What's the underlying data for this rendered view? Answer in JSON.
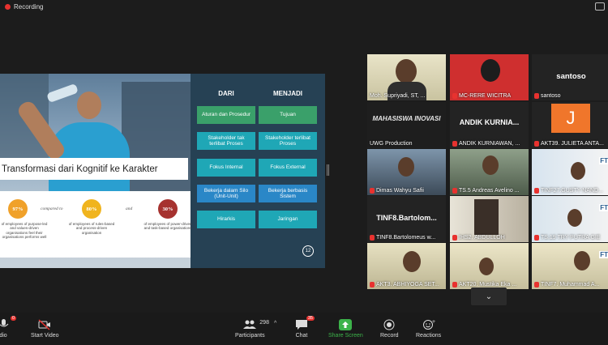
{
  "recording": {
    "label": "Recording"
  },
  "slide": {
    "title": "Transformasi dari Kognitif ke Karakter",
    "col_left_header": "DARI",
    "col_right_header": "MENJADI",
    "rows": [
      {
        "from": "Aturan dan Prosedur",
        "to": "Tujuan"
      },
      {
        "from": "Stakeholder tak terlibat Proses",
        "to": "Stakeholder terlibat Proses"
      },
      {
        "from": "Fokus Internal",
        "to": "Fokus External"
      },
      {
        "from": "Bekerja dalam Silo (Unit-Unit)",
        "to": "Bekerja berbasis Sistem"
      },
      {
        "from": "Hirarkis",
        "to": "Jaringan"
      }
    ],
    "stats": [
      {
        "value": "97%",
        "desc": "of employees of purpose-led and values-driven organisations feel their organisations performs well"
      },
      {
        "value": "80%",
        "desc": "of employees of rules-based and process-driven organisation"
      },
      {
        "value": "30%",
        "desc": "of employees of power-driven and task-based organisations"
      }
    ],
    "compared_to": "compared to",
    "and": "and",
    "page_number": "12"
  },
  "participants": [
    {
      "name": "Moh. Supriyadi, ST, ...",
      "muted": false,
      "active": true
    },
    {
      "name": "MC-RERE WICITRA",
      "muted": true
    },
    {
      "name": "santoso",
      "muted": true,
      "label": "santoso"
    },
    {
      "name": "UWG Production",
      "muted": false,
      "label": "MAHASISWA INOVASI"
    },
    {
      "name": "ANDIK KURNIAWAN, ...",
      "muted": true,
      "label": "ANDIK KURNIA..."
    },
    {
      "name": "AKT39. JULIETA ANTA...",
      "muted": true,
      "avatar": "J"
    },
    {
      "name": "Dimas Wahyu Safii",
      "muted": true
    },
    {
      "name": "TS.5 Andreas Avelino ...",
      "muted": true
    },
    {
      "name": "TINF27.GUSTY NAND...",
      "muted": true
    },
    {
      "name": "TINF8.Bartolomeus w...",
      "muted": true,
      "label": "TINF8.Bartolom..."
    },
    {
      "name": "IHS2. ABDULLOH",
      "muted": true
    },
    {
      "name": "TS.19 TRY PUTRA GIE",
      "muted": true
    },
    {
      "name": "AKT3. ABHIYOGA SET...",
      "muted": true
    },
    {
      "name": "AKT20. Mustika Eka ...",
      "muted": true
    },
    {
      "name": "TINF7. Muhammad A...",
      "muted": true
    }
  ],
  "toolbar": {
    "audio": "dio",
    "audio_badge": "0",
    "video": "Start Video",
    "participants": "Participants",
    "participants_count": "298",
    "chat": "Chat",
    "chat_badge": "35",
    "share": "Share Screen",
    "record": "Record",
    "reactions": "Reactions"
  },
  "colors": {
    "accent_green": "#3cb34a",
    "alert_red": "#e8322f",
    "active_border": "#e6d63e"
  }
}
